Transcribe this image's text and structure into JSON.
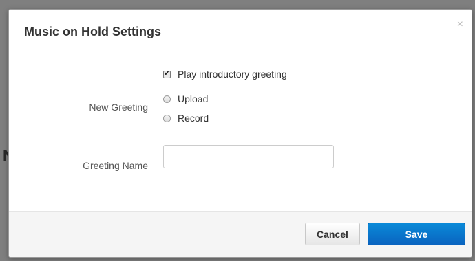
{
  "backdrop": {
    "peek_text": "N"
  },
  "modal": {
    "title": "Music on Hold Settings",
    "close_glyph": "×"
  },
  "form": {
    "play_greeting": {
      "label": "Play introductory greeting",
      "checked": true
    },
    "new_greeting": {
      "label": "New Greeting",
      "options": [
        {
          "label": "Upload",
          "selected": false
        },
        {
          "label": "Record",
          "selected": false
        }
      ]
    },
    "greeting_name": {
      "label": "Greeting Name",
      "value": "",
      "placeholder": ""
    }
  },
  "footer": {
    "cancel_label": "Cancel",
    "save_label": "Save"
  },
  "colors": {
    "primary": "#0a72cc",
    "overlay": "#7f7f7f"
  },
  "icons": {
    "close": "close-icon",
    "checkbox": "checkbox-checked-icon",
    "radio": "radio-unselected-icon"
  }
}
